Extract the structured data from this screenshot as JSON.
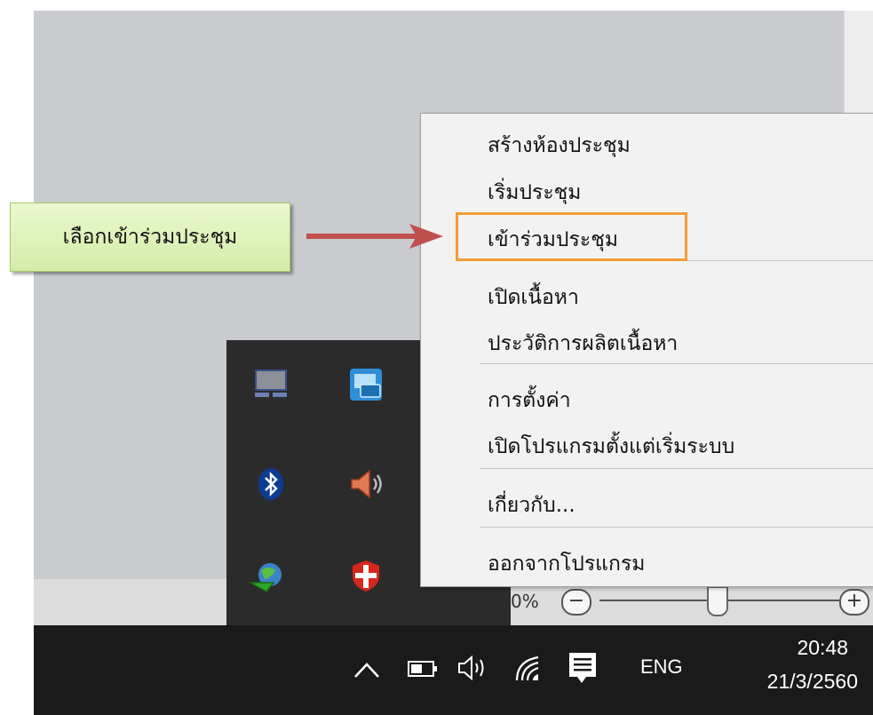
{
  "callout": {
    "text": "เลือกเข้าร่วมประชุม"
  },
  "context_menu": {
    "items": [
      {
        "label": "สร้างห้องประชุม"
      },
      {
        "label": "เริ่มประชุม"
      },
      {
        "label": "เข้าร่วมประชุม",
        "highlighted": true
      },
      {
        "label": "เปิดเนื้อหา"
      },
      {
        "label": "ประวัติการผลิตเนื้อหา"
      },
      {
        "label": "การตั้งค่า"
      },
      {
        "label": "เปิดโปรแกรมตั้งแต่เริ่มระบบ"
      },
      {
        "label": "เกี่ยวกับ..."
      },
      {
        "label": "ออกจากโปรแกรม"
      }
    ]
  },
  "zoom": {
    "percent_text": "0%",
    "minus": "−",
    "plus": "+"
  },
  "tray_icons": [
    "laptop-icon",
    "intel-graphics-icon",
    "bluetooth-icon",
    "speaker-icon",
    "download-manager-icon",
    "antivirus-shield-icon"
  ],
  "taskbar": {
    "language": "ENG",
    "time": "20:48",
    "date": "21/3/2560",
    "icons": [
      "chevron-up-icon",
      "battery-icon",
      "volume-icon",
      "wifi-icon",
      "notification-icon"
    ]
  },
  "colors": {
    "highlight_border": "#f39c38",
    "arrow": "#c0504d",
    "callout_fill": "#d4eda8",
    "taskbar_bg": "#1a1a1a",
    "tray_bg": "#2b2b2b"
  }
}
